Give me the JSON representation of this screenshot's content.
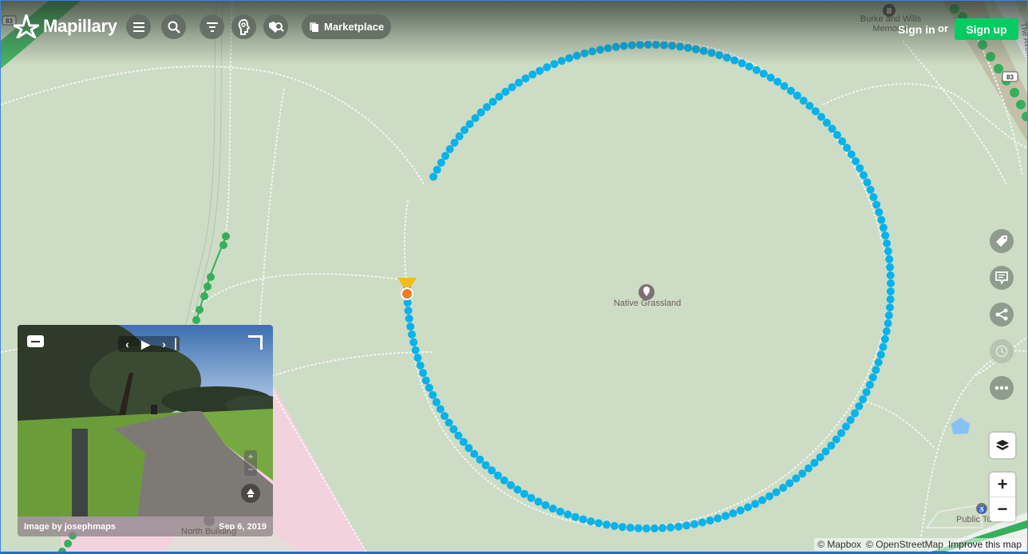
{
  "app": {
    "brand": "Mapillary",
    "accent_color": "#05cb63",
    "sequence_color": "#08b2ea",
    "coverage_color": "#35af5b"
  },
  "header": {
    "buttons": [
      {
        "name": "menu-button",
        "icon": "hamburger-icon"
      },
      {
        "name": "search-button",
        "icon": "search-icon"
      },
      {
        "name": "filter-button",
        "icon": "filter-icon"
      },
      {
        "name": "ai-detections-button",
        "icon": "head-profile-icon"
      },
      {
        "name": "map-features-button",
        "icon": "tag-search-icon"
      }
    ],
    "marketplace_label": "Marketplace",
    "signin_label": "Sign in",
    "or_label": "or",
    "signup_label": "Sign up"
  },
  "map": {
    "labels": {
      "native_grassland": "Native Grassland",
      "burke_wills_line1": "Burke and Wills",
      "burke_wills_line2": "Memorial",
      "the_avenue": "The Avenue",
      "route_83": "83",
      "public_toilet": "Public To",
      "north_building": "North Building"
    },
    "attribution": {
      "mapbox": "© Mapbox",
      "osm": "© OpenStreetMap",
      "improve": "Improve this map"
    }
  },
  "right_controls": [
    {
      "name": "tag-button",
      "icon": "tag-icon",
      "enabled": true
    },
    {
      "name": "comment-button",
      "icon": "comment-icon",
      "enabled": true
    },
    {
      "name": "share-button",
      "icon": "share-icon",
      "enabled": true
    },
    {
      "name": "time-travel-button",
      "icon": "clock-icon",
      "enabled": false
    },
    {
      "name": "more-button",
      "icon": "more-icon",
      "enabled": true
    }
  ],
  "zoom_controls": {
    "in": "+",
    "out": "−"
  },
  "viewer": {
    "credit": "Image by josephmaps",
    "date": "Sep 6, 2019",
    "nav": {
      "prev": "‹",
      "play": "▶",
      "next": "›"
    },
    "zoom_in": "+",
    "zoom_out": "−"
  }
}
